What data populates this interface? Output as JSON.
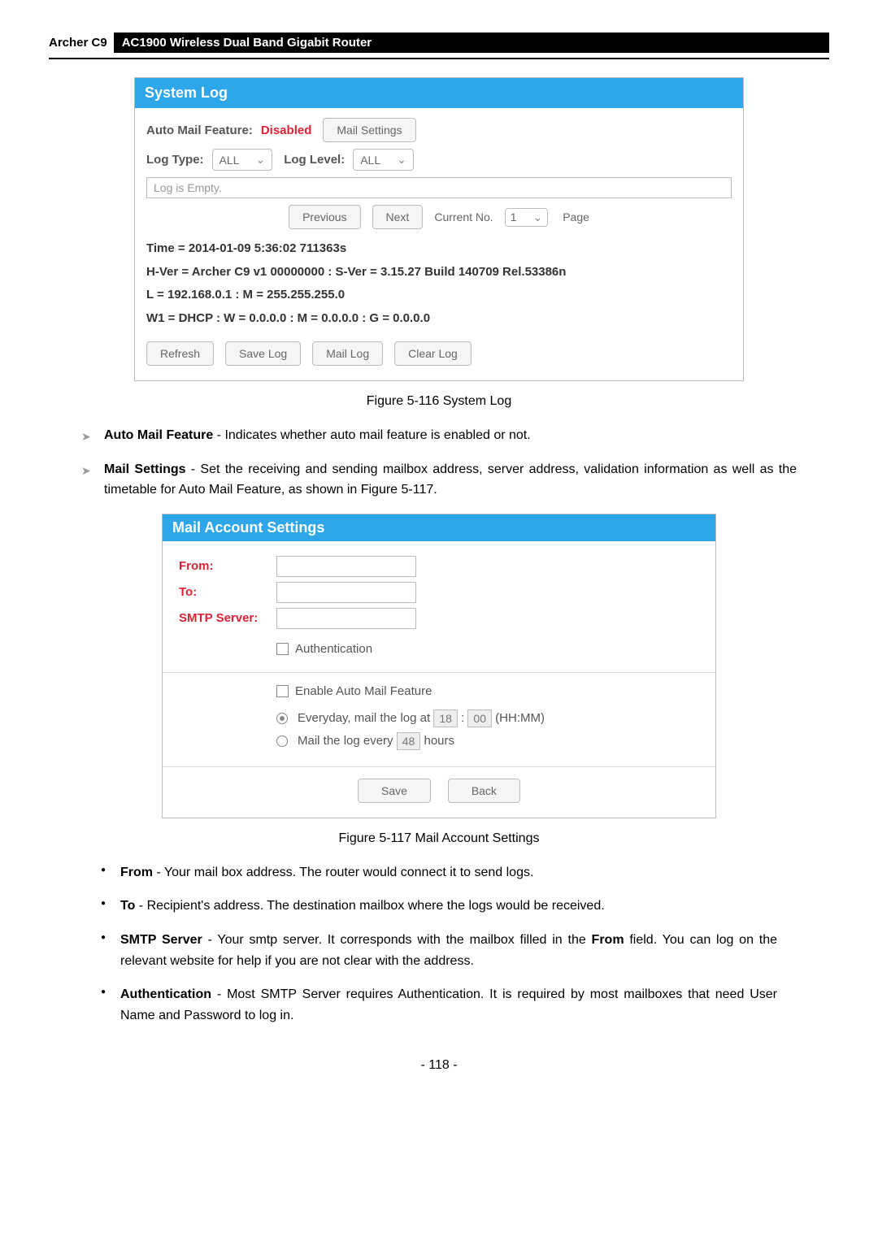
{
  "header": {
    "model": "Archer C9",
    "title": "AC1900 Wireless Dual Band Gigabit Router"
  },
  "systemLog": {
    "panelTitle": "System Log",
    "autoMailLabel": "Auto Mail Feature:",
    "autoMailValue": "Disabled",
    "mailSettingsBtn": "Mail Settings",
    "logTypeLabel": "Log Type:",
    "logTypeValue": "ALL",
    "logLevelLabel": "Log Level:",
    "logLevelValue": "ALL",
    "logEmpty": "Log is Empty.",
    "pager": {
      "prev": "Previous",
      "next": "Next",
      "currentLabel": "Current No.",
      "currentVal": "1",
      "pageWord": "Page"
    },
    "lines": [
      "Time = 2014-01-09 5:36:02 711363s",
      "H-Ver = Archer C9 v1 00000000 : S-Ver = 3.15.27 Build 140709 Rel.53386n",
      "L = 192.168.0.1 : M = 255.255.255.0",
      "W1 = DHCP : W = 0.0.0.0 : M = 0.0.0.0 : G = 0.0.0.0"
    ],
    "buttons": [
      "Refresh",
      "Save Log",
      "Mail Log",
      "Clear Log"
    ]
  },
  "fig1": "Figure 5-116 System Log",
  "bullets1": [
    {
      "term": "Auto Mail Feature",
      "text": " - Indicates whether auto mail feature is enabled or not."
    },
    {
      "term": "Mail Settings",
      "text": " - Set the receiving and sending mailbox address, server address, validation information as well as the timetable for Auto Mail Feature, as shown in Figure 5-117."
    }
  ],
  "mailPanel": {
    "title": "Mail Account Settings",
    "from": "From:",
    "to": "To:",
    "smtp": "SMTP Server:",
    "authLabel": "Authentication",
    "enableLabel": "Enable Auto Mail Feature",
    "opt1prefix": "Everyday, mail the log at",
    "opt1h": "18",
    "opt1m": "00",
    "opt1suffix": "(HH:MM)",
    "opt2prefix": "Mail the log every",
    "opt2val": "48",
    "opt2suffix": "hours",
    "save": "Save",
    "back": "Back"
  },
  "fig2": "Figure 5-117 Mail Account Settings",
  "bullets2": [
    {
      "term": "From",
      "text": " - Your mail box address. The router would connect it to send logs."
    },
    {
      "term": "To",
      "text": " - Recipient's address. The destination mailbox where the logs would be received."
    },
    {
      "term": "SMTP Server",
      "text": " - Your smtp server. It corresponds with the mailbox filled in the ",
      "term2": "From",
      "text2": " field. You can log on the relevant website for help if you are not clear with the address."
    },
    {
      "term": "Authentication",
      "text": " - Most SMTP Server requires Authentication. It is required by most mailboxes that need User Name and Password to log in."
    }
  ],
  "pageNum": "- 118 -"
}
